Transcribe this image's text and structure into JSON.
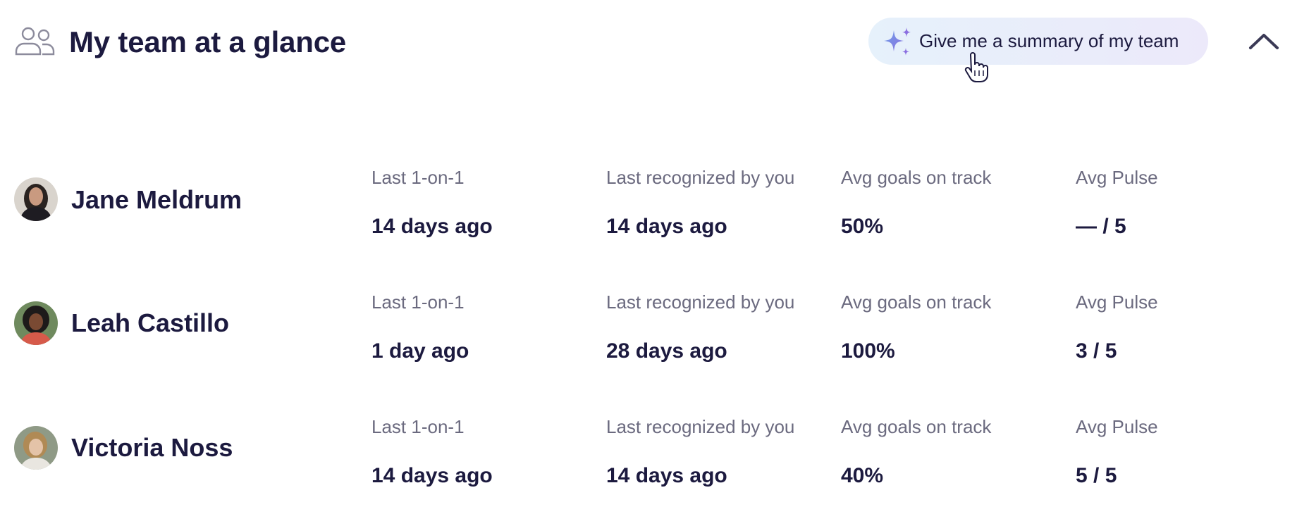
{
  "header": {
    "title": "My team at a glance",
    "summary_button_label": "Give me a summary of my team",
    "team_icon": "people-icon",
    "sparkle_icon": "sparkle-icon",
    "collapse_icon": "chevron-up-icon"
  },
  "colors": {
    "text_primary": "#1c1a3f",
    "text_secondary": "#6b6a7f",
    "button_bg_start": "#e6f1fb",
    "button_bg_end": "#ece9fa",
    "sparkle_blue": "#6ea0e8",
    "sparkle_purple": "#8b6fe0"
  },
  "team": [
    {
      "name": "Jane Meldrum",
      "stats": [
        {
          "label": "Last 1-on-1",
          "value": "14 days ago"
        },
        {
          "label": "Last recognized by you",
          "value": "14 days ago"
        },
        {
          "label": "Avg goals on track",
          "value": "50%"
        },
        {
          "label": "Avg Pulse",
          "value": "— / 5"
        }
      ]
    },
    {
      "name": "Leah Castillo",
      "stats": [
        {
          "label": "Last 1-on-1",
          "value": "1 day ago"
        },
        {
          "label": "Last recognized by you",
          "value": "28 days ago"
        },
        {
          "label": "Avg goals on track",
          "value": "100%"
        },
        {
          "label": "Avg Pulse",
          "value": "3 / 5"
        }
      ]
    },
    {
      "name": "Victoria Noss",
      "stats": [
        {
          "label": "Last 1-on-1",
          "value": "14 days ago"
        },
        {
          "label": "Last recognized by you",
          "value": "14 days ago"
        },
        {
          "label": "Avg goals on track",
          "value": "40%"
        },
        {
          "label": "Avg Pulse",
          "value": "5 / 5"
        }
      ]
    }
  ]
}
